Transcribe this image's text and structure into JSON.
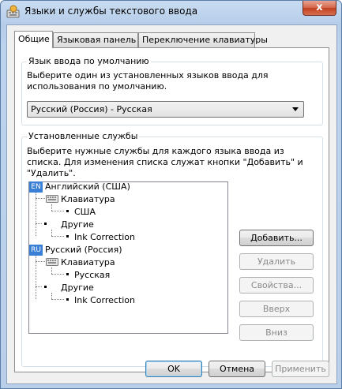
{
  "window": {
    "title": "Языки и службы текстового ввода",
    "close_label": "x"
  },
  "tabs": [
    {
      "label": "Общие"
    },
    {
      "label": "Языковая панель"
    },
    {
      "label": "Переключение клавиатуры"
    }
  ],
  "default_language": {
    "legend": "Язык ввода по умолчанию",
    "description": "Выберите один из установленных языков ввода для использования по умолчанию.",
    "selected": "Русский (Россия) - Русская"
  },
  "installed_services": {
    "legend": "Установленные службы",
    "description": "Выберите нужные службы для каждого языка ввода из списка. Для изменения списка служат кнопки \"Добавить\" и \"Удалить\".",
    "tree": {
      "en": {
        "badge": "EN",
        "label": "Английский (США)",
        "keyboard": "Клавиатура",
        "layout": "США",
        "other": "Другие",
        "service": "Ink Correction"
      },
      "ru": {
        "badge": "RU",
        "label": "Русский (Россия)",
        "keyboard": "Клавиатура",
        "layout": "Русская",
        "other": "Другие",
        "service": "Ink Correction"
      }
    },
    "buttons": {
      "add": "Добавить...",
      "remove": "Удалить",
      "properties": "Свойства...",
      "up": "Вверх",
      "down": "Вниз"
    }
  },
  "footer": {
    "ok": "OK",
    "cancel": "Отмена",
    "apply": "Применить"
  }
}
